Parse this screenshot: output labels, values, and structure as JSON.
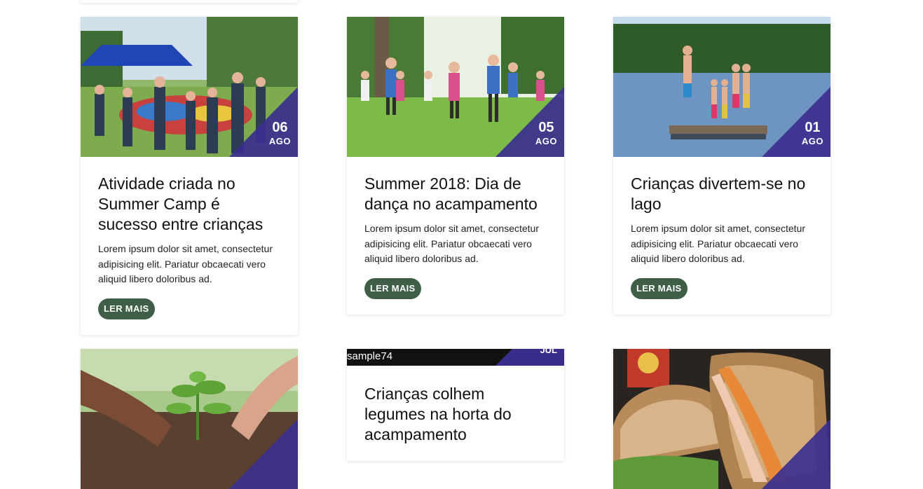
{
  "accent_color": "#3b2f8f",
  "button_color": "#3f5e48",
  "posts": [
    {
      "image_icon": "photo-children-parachute-game",
      "date_day": "06",
      "date_month": "AGO",
      "title": "Atividade criada no Summer Camp é sucesso entre crianças",
      "excerpt": "Lorem ipsum dolor sit amet, consectetur adipisicing elit. Pariatur obcaecati vero aliquid libero doloribus ad.",
      "button": "LER MAIS"
    },
    {
      "image_icon": "photo-children-dancing-field",
      "date_day": "05",
      "date_month": "AGO",
      "title": "Summer 2018: Dia de dança no acampamento",
      "excerpt": "Lorem ipsum dolor sit amet, consectetur adipisicing elit. Pariatur obcaecati vero aliquid libero doloribus ad.",
      "button": "LER MAIS"
    },
    {
      "image_icon": "photo-children-lake-dock",
      "date_day": "01",
      "date_month": "AGO",
      "title": "Crianças divertem-se no lago",
      "excerpt": "Lorem ipsum dolor sit amet, consectetur adipisicing elit. Pariatur obcaecati vero aliquid libero doloribus ad.",
      "button": "LER MAIS"
    },
    {
      "image_icon": "photo-hands-planting-seedling"
    },
    {
      "image_alt": "sample74",
      "date_month": "JUL",
      "title": "Crianças colhem legumes na horta do acampamento"
    },
    {
      "image_icon": "photo-sandwiches"
    }
  ]
}
